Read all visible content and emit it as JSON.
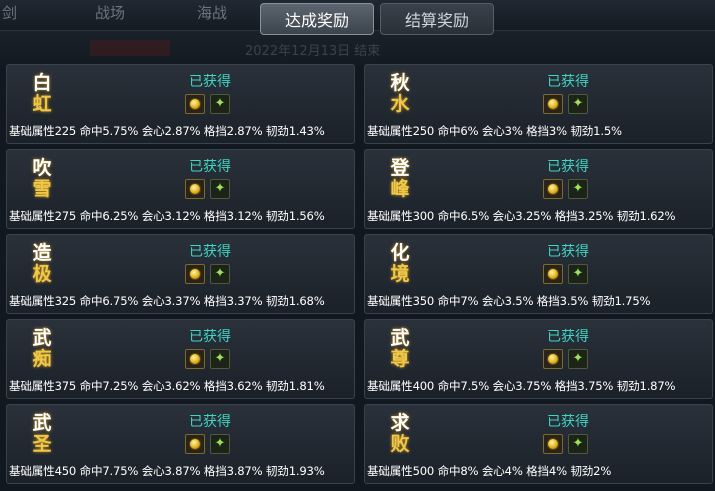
{
  "background": {
    "tabs": [
      "剑",
      "战场",
      "海战"
    ],
    "faded_line": "2022年12月13日 结束"
  },
  "tabs": {
    "achieve": "达成奖励",
    "settle": "结算奖励"
  },
  "icons": {
    "reward_1": "gold-coin-icon",
    "reward_2": "green-sparkle-icon"
  },
  "colors": {
    "status": "#3ed6c4",
    "title_glow": "#d8a83a"
  },
  "cards": [
    {
      "name_top": "白",
      "name_bottom": "虹",
      "status": "已获得",
      "attrs": "基础属性225 命中5.75% 会心2.87% 格挡2.87% 韧劲1.43%"
    },
    {
      "name_top": "秋",
      "name_bottom": "水",
      "status": "已获得",
      "attrs": "基础属性250 命中6% 会心3% 格挡3% 韧劲1.5%"
    },
    {
      "name_top": "吹",
      "name_bottom": "雪",
      "status": "已获得",
      "attrs": "基础属性275 命中6.25% 会心3.12% 格挡3.12% 韧劲1.56%"
    },
    {
      "name_top": "登",
      "name_bottom": "峰",
      "status": "已获得",
      "attrs": "基础属性300 命中6.5% 会心3.25% 格挡3.25% 韧劲1.62%"
    },
    {
      "name_top": "造",
      "name_bottom": "极",
      "status": "已获得",
      "attrs": "基础属性325 命中6.75% 会心3.37% 格挡3.37% 韧劲1.68%"
    },
    {
      "name_top": "化",
      "name_bottom": "境",
      "status": "已获得",
      "attrs": "基础属性350 命中7% 会心3.5% 格挡3.5% 韧劲1.75%"
    },
    {
      "name_top": "武",
      "name_bottom": "痴",
      "status": "已获得",
      "attrs": "基础属性375 命中7.25% 会心3.62% 格挡3.62% 韧劲1.81%"
    },
    {
      "name_top": "武",
      "name_bottom": "尊",
      "status": "已获得",
      "attrs": "基础属性400 命中7.5% 会心3.75% 格挡3.75% 韧劲1.87%"
    },
    {
      "name_top": "武",
      "name_bottom": "圣",
      "status": "已获得",
      "attrs": "基础属性450 命中7.75% 会心3.87% 格挡3.87% 韧劲1.93%"
    },
    {
      "name_top": "求",
      "name_bottom": "败",
      "status": "已获得",
      "attrs": "基础属性500 命中8% 会心4% 格挡4% 韧劲2%"
    }
  ]
}
